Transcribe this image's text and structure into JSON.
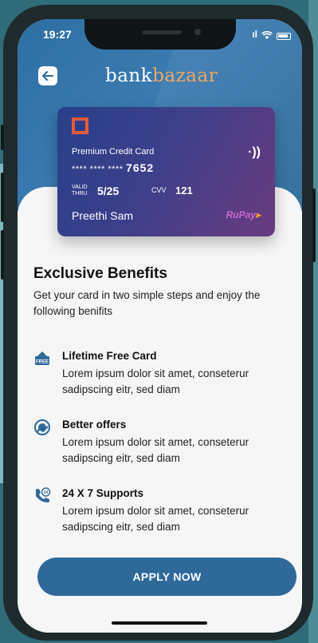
{
  "status_bar": {
    "time": "19:27",
    "signal": "ıl"
  },
  "header": {
    "logo_part1": "bank",
    "logo_part2": "bazaar"
  },
  "card": {
    "type_label": "Premium Credit Card",
    "number_masked": "**** **** ****",
    "number_last4": "7652",
    "valid_label_line1": "VALID",
    "valid_label_line2": "THRU",
    "valid_thru": "5/25",
    "cvv_label": "CVV",
    "cvv_value": "121",
    "holder_name": "Preethi Sam",
    "network": "RuPay",
    "contactless_glyph": "·))"
  },
  "content": {
    "title": "Exclusive Benefits",
    "subtitle": "Get your card in two simple steps and enjoy the following benifits",
    "benefits": [
      {
        "title": "Lifetime Free Card",
        "description": "Lorem ipsum dolor sit amet, conseterur sadipscing eitr, sed diam",
        "icon": "free-badge-icon"
      },
      {
        "title": "Better offers",
        "description": "Lorem ipsum dolor sit amet, conseterur sadipscing eitr, sed diam",
        "icon": "offers-icon"
      },
      {
        "title": "24 X 7 Supports",
        "description": "Lorem ipsum dolor sit amet, conseterur sadipscing eitr, sed diam",
        "icon": "support-phone-icon"
      }
    ]
  },
  "cta": {
    "label": "APPLY NOW"
  },
  "colors": {
    "primary": "#2e699a",
    "accent": "#f0a860",
    "chip": "#e45a3a"
  }
}
